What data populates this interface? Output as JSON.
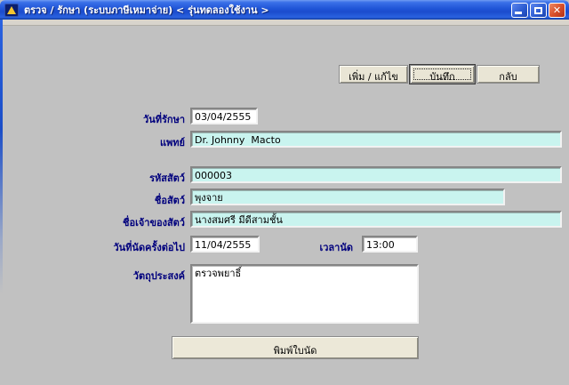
{
  "window": {
    "title": "ตรวจ / รักษา (ระบบภาษีเหมาจ่าย) < รุ่นทดลองใช้งาน >",
    "icon": "warning-triangle-icon",
    "controls": [
      "minimize",
      "maximize",
      "close"
    ]
  },
  "toolbar": {
    "add_edit_label": "เพิ่ม / แก้ไข",
    "save_label": "บันทึก",
    "back_label": "กลับ"
  },
  "form": {
    "treatment_date": {
      "label": "วันที่รักษา",
      "value": "03/04/2555"
    },
    "doctor": {
      "label": "แพทย์",
      "value": "Dr. Johnny  Macto"
    },
    "animal_code": {
      "label": "รหัสสัตว์",
      "value": "000003"
    },
    "animal_name": {
      "label": "ชื่อสัตว์",
      "value": "พุงจาย"
    },
    "owner_name": {
      "label": "ชื่อเจ้าของสัตว์",
      "value": "นางสมศรี มีดีสามชั้น"
    },
    "next_appointment_date": {
      "label": "วันที่นัดครั้งต่อไป",
      "value": "11/04/2555"
    },
    "appointment_time": {
      "label": "เวลานัด",
      "value": "13:00"
    },
    "purpose": {
      "label": "วัตถุประสงค์",
      "value": "ตรวจพยาธิ์"
    },
    "print_button_label": "พิมพ์ใบนัด"
  },
  "colors": {
    "titlebar_blue": "#1f54d6",
    "body_gray": "#c1c1c1",
    "field_cyan": "#c9f4ef",
    "field_white": "#ffffff",
    "label_navy": "#00007d",
    "button_face": "#e9e5d5",
    "close_red": "#d9512c"
  }
}
